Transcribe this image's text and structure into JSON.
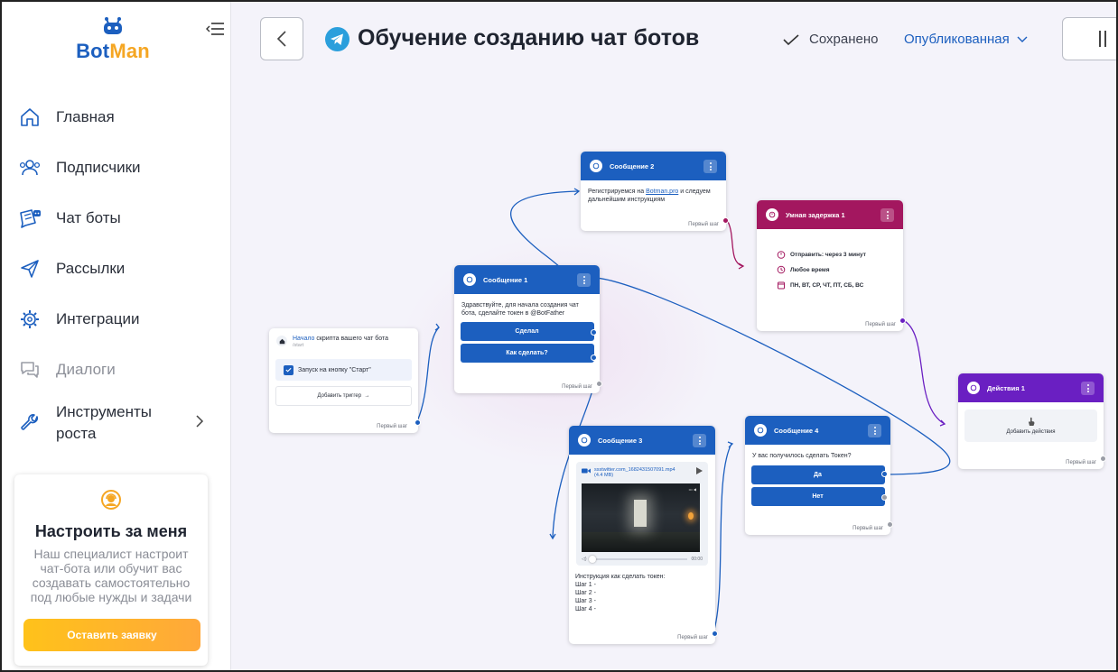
{
  "sidebar": {
    "logo": {
      "bot": "Bot",
      "man": "Man"
    },
    "nav": [
      {
        "label": "Главная",
        "icon": "home-icon"
      },
      {
        "label": "Подписчики",
        "icon": "users-icon"
      },
      {
        "label": "Чат боты",
        "icon": "chatbot-icon"
      },
      {
        "label": "Рассылки",
        "icon": "send-icon"
      },
      {
        "label": "Интеграции",
        "icon": "integrations-icon"
      },
      {
        "label": "Диалоги",
        "icon": "dialogs-icon"
      },
      {
        "label": "Инструменты роста",
        "icon": "wrench-icon"
      }
    ],
    "promo": {
      "title": "Настроить за меня",
      "text": "Наш специалист настроит чат-бота или обучит вас создавать самостоятельно под любые нужды и задачи",
      "button": "Оставить заявку"
    }
  },
  "header": {
    "title": "Обучение созданию чат ботов",
    "saved": "Сохранено",
    "status": "Опубликованная"
  },
  "nodes": {
    "start": {
      "title_highlight": "Начало",
      "title_rest": " скрипта вашего чат бота",
      "subtitle": "/start",
      "trigger": "Запуск на кнопку \"Старт\"",
      "add_trigger": "Добавить триггер",
      "footer": "Первый шаг"
    },
    "msg1": {
      "title": "Сообщение 1",
      "text": "Здравствуйте, для начала создания чат бота, сделайте токен в @BotFather",
      "buttons": [
        "Сделал",
        "Как сделать?"
      ],
      "footer": "Первый шаг"
    },
    "msg2": {
      "title": "Сообщение 2",
      "text_before": "Регистрируемся на ",
      "link": "Botman.pro",
      "text_after": " и следуем дальнейшим инструкциям",
      "footer": "Первый шаг"
    },
    "delay": {
      "title": "Умная задержка 1",
      "rows": [
        "Отправить: через 3 минут",
        "Любое время",
        "ПН, ВТ, СР, ЧТ, ПТ, СБ, ВС"
      ],
      "footer": "Первый шаг"
    },
    "msg3": {
      "title": "Сообщение 3",
      "file": "ssstwitter.com_1682431507091.mp4",
      "size": "(4.4 MB)",
      "time": "00:00",
      "text": [
        "Инструкция как сделать токен:",
        "Шаг 1 -",
        "Шаг 2 -",
        "Шаг 3 -",
        "Шаг 4 -"
      ],
      "footer": "Первый шаг"
    },
    "msg4": {
      "title": "Сообщение 4",
      "text": "У вас получилось сделать Токен?",
      "buttons": [
        "Да",
        "Нет"
      ],
      "footer": "Первый шаг"
    },
    "action": {
      "title": "Действия 1",
      "add": "Добавить действия",
      "footer": "Первый шаг"
    }
  },
  "colors": {
    "brand_blue": "#1c5fbf",
    "brand_orange": "#f5a623",
    "delay": "#a3175f",
    "action": "#6a1fc2"
  }
}
